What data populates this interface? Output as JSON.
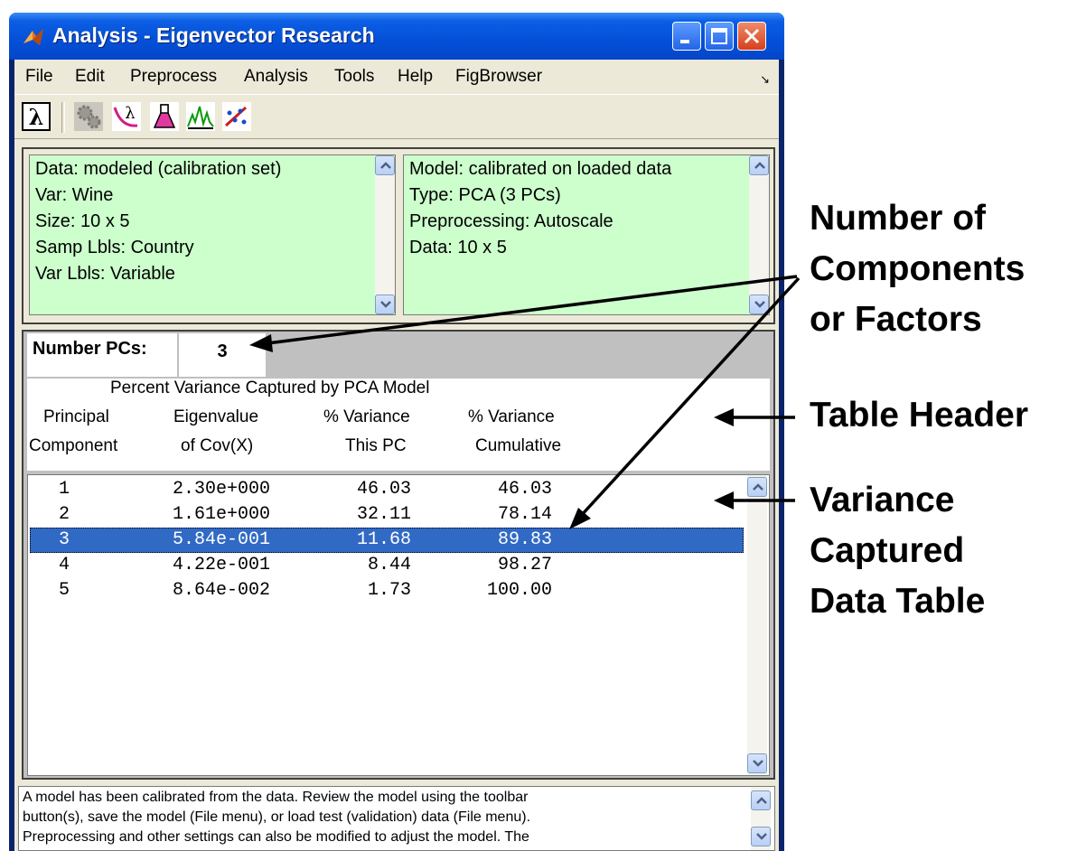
{
  "window": {
    "title": "Analysis - Eigenvector Research"
  },
  "menu": {
    "items": [
      "File",
      "Edit",
      "Preprocess",
      "Analysis",
      "Tools",
      "Help",
      "FigBrowser"
    ],
    "overflow_icon": "dock-arrow-icon"
  },
  "toolbar": {
    "icons": [
      "lambda-icon",
      "gear-icon",
      "lambda-curve-icon",
      "flask-icon",
      "peaks-icon",
      "scatter-icon"
    ]
  },
  "data_info": {
    "lines": [
      "Data: modeled (calibration set)",
      "Var: Wine",
      "Size: 10 x 5",
      "Samp Lbls: Country",
      "Var Lbls: Variable"
    ]
  },
  "model_info": {
    "lines": [
      "Model: calibrated on loaded data",
      "Type: PCA (3 PCs)",
      "Preprocessing: Autoscale",
      "Data: 10 x 5"
    ]
  },
  "pcs": {
    "label": "Number PCs:",
    "value": "3"
  },
  "table": {
    "title": "Percent Variance Captured by PCA Model",
    "columns": [
      {
        "line1": "Principal",
        "line2": "Component"
      },
      {
        "line1": "Eigenvalue",
        "line2": "of Cov(X)"
      },
      {
        "line1": "% Variance",
        "line2": "This  PC"
      },
      {
        "line1": "% Variance",
        "line2": "Cumulative"
      }
    ],
    "rows": [
      [
        "1",
        "2.30e+000",
        "46.03",
        "46.03"
      ],
      [
        "2",
        "1.61e+000",
        "32.11",
        "78.14"
      ],
      [
        "3",
        "5.84e-001",
        "11.68",
        "89.83"
      ],
      [
        "4",
        "4.22e-001",
        "8.44",
        "98.27"
      ],
      [
        "5",
        "8.64e-002",
        "1.73",
        "100.00"
      ]
    ],
    "selected_row": 3
  },
  "status": {
    "lines": [
      "A model has been calibrated from the data. Review the model using the toolbar",
      "button(s), save the model (File menu), or load test (validation) data (File menu).",
      "Preprocessing and other settings can also be modified to adjust the model. The"
    ]
  },
  "annotations": {
    "components": [
      "Number of",
      "Components",
      "or Factors"
    ],
    "header": [
      "Table Header"
    ],
    "data_table": [
      "Variance",
      "Captured",
      "Data Table"
    ]
  }
}
